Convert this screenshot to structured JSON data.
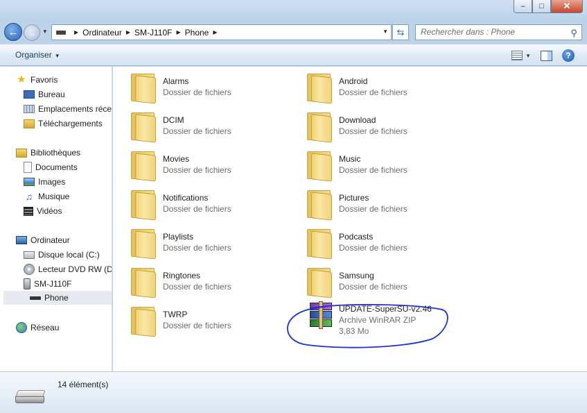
{
  "window": {
    "minimize_glyph": "‒",
    "maximize_glyph": "□",
    "close_glyph": "✕"
  },
  "address": {
    "crumbs": [
      "Ordinateur",
      "SM-J110F",
      "Phone"
    ],
    "search_placeholder": "Rechercher dans : Phone"
  },
  "toolbar": {
    "organiser_label": "Organiser"
  },
  "sidebar": {
    "favorites": {
      "header": "Favoris",
      "items": [
        "Bureau",
        "Emplacements récents",
        "Téléchargements"
      ]
    },
    "libraries": {
      "header": "Bibliothèques",
      "items": [
        "Documents",
        "Images",
        "Musique",
        "Vidéos"
      ]
    },
    "computer": {
      "header": "Ordinateur",
      "items": [
        "Disque local (C:)",
        "Lecteur DVD RW (D:)",
        "SM-J110F",
        "Phone"
      ]
    },
    "network": {
      "header": "Réseau"
    }
  },
  "files": [
    {
      "name": "Alarms",
      "type": "Dossier de fichiers"
    },
    {
      "name": "Android",
      "type": "Dossier de fichiers"
    },
    {
      "name": "DCIM",
      "type": "Dossier de fichiers"
    },
    {
      "name": "Download",
      "type": "Dossier de fichiers"
    },
    {
      "name": "Movies",
      "type": "Dossier de fichiers"
    },
    {
      "name": "Music",
      "type": "Dossier de fichiers"
    },
    {
      "name": "Notifications",
      "type": "Dossier de fichiers"
    },
    {
      "name": "Pictures",
      "type": "Dossier de fichiers"
    },
    {
      "name": "Playlists",
      "type": "Dossier de fichiers"
    },
    {
      "name": "Podcasts",
      "type": "Dossier de fichiers"
    },
    {
      "name": "Ringtones",
      "type": "Dossier de fichiers"
    },
    {
      "name": "Samsung",
      "type": "Dossier de fichiers"
    },
    {
      "name": "TWRP",
      "type": "Dossier de fichiers"
    },
    {
      "name": "UPDATE-SuperSU-v2.46",
      "type": "Archive WinRAR ZIP",
      "size": "3,83 Mo"
    }
  ],
  "status": {
    "item_count": "14 élément(s)"
  },
  "colors": {
    "annotation_circle": "#1a2fd6",
    "selection": "#e5eaf0"
  }
}
